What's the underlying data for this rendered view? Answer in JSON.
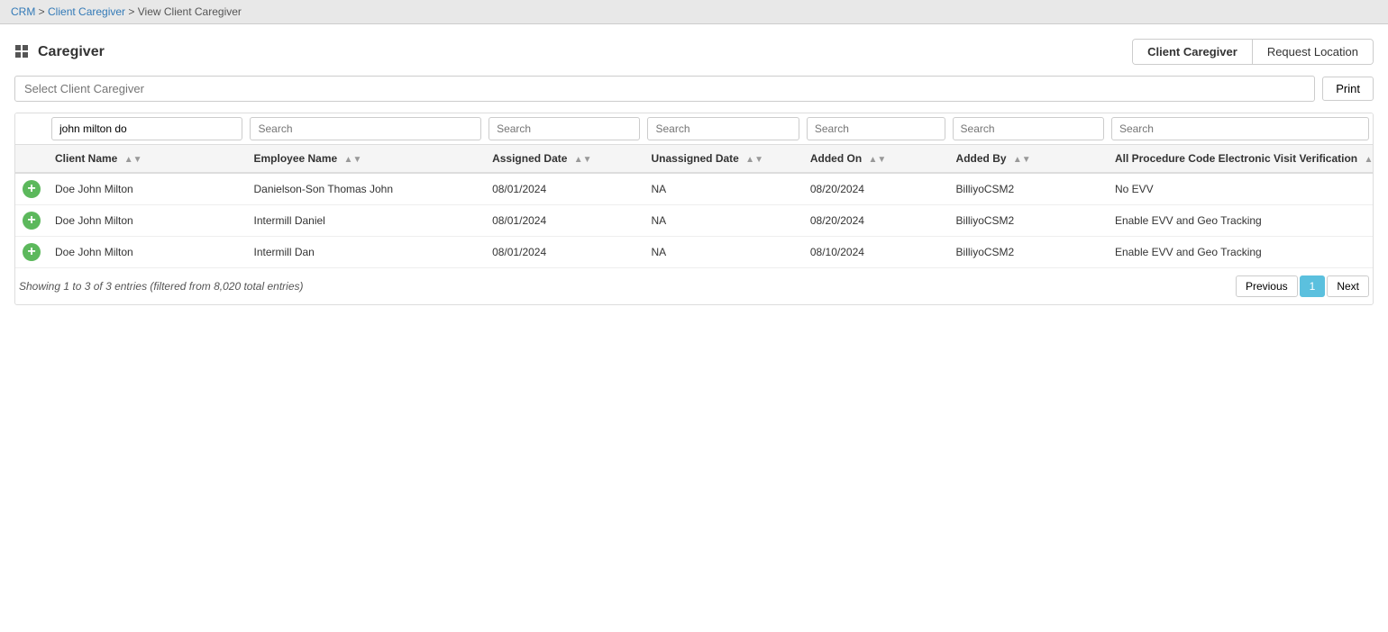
{
  "breadcrumb": {
    "crm": "CRM",
    "separator1": " > ",
    "client_caregiver": "Client Caregiver",
    "separator2": " > ",
    "current": "View Client Caregiver"
  },
  "header": {
    "icon": "⊞",
    "title": "Caregiver",
    "tabs": [
      {
        "label": "Client Caregiver",
        "active": true
      },
      {
        "label": "Request Location",
        "active": false
      }
    ]
  },
  "toolbar": {
    "select_placeholder": "Select Client Caregiver",
    "print_label": "Print"
  },
  "search_filters": {
    "client_name": "john milton do",
    "employee_name": "Search",
    "assigned_date": "Search",
    "unassigned_date": "Search",
    "added_on": "Search",
    "added_by": "Search",
    "evv": "Search"
  },
  "table": {
    "columns": [
      {
        "key": "action",
        "label": ""
      },
      {
        "key": "client_name",
        "label": "Client Name"
      },
      {
        "key": "employee_name",
        "label": "Employee Name"
      },
      {
        "key": "assigned_date",
        "label": "Assigned Date"
      },
      {
        "key": "unassigned_date",
        "label": "Unassigned Date"
      },
      {
        "key": "added_on",
        "label": "Added On"
      },
      {
        "key": "added_by",
        "label": "Added By"
      },
      {
        "key": "evv",
        "label": "All Procedure Code Electronic Visit Verification"
      }
    ],
    "rows": [
      {
        "client_name": "Doe John Milton",
        "employee_name": "Danielson-Son Thomas John",
        "assigned_date": "08/01/2024",
        "unassigned_date": "NA",
        "added_on": "08/20/2024",
        "added_by": "BilliyoCSM2",
        "evv": "No EVV"
      },
      {
        "client_name": "Doe John Milton",
        "employee_name": "Intermill Daniel",
        "assigned_date": "08/01/2024",
        "unassigned_date": "NA",
        "added_on": "08/20/2024",
        "added_by": "BilliyoCSM2",
        "evv": "Enable EVV and Geo Tracking"
      },
      {
        "client_name": "Doe John Milton",
        "employee_name": "Intermill Dan",
        "assigned_date": "08/01/2024",
        "unassigned_date": "NA",
        "added_on": "08/10/2024",
        "added_by": "BilliyoCSM2",
        "evv": "Enable EVV and Geo Tracking"
      }
    ]
  },
  "footer": {
    "summary": "Showing 1 to 3 of 3 entries (filtered from 8,020 total entries)",
    "prev_label": "Previous",
    "next_label": "Next",
    "current_page": "1"
  }
}
